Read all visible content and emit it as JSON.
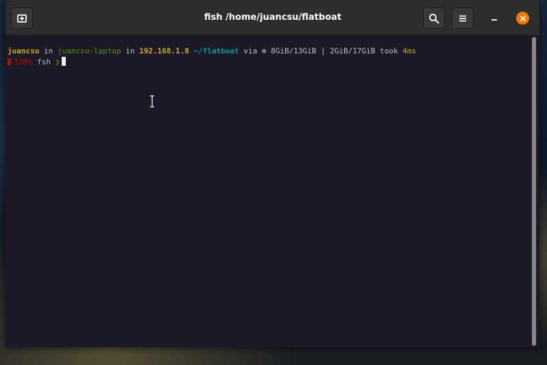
{
  "window": {
    "title": "fish /home/juancsu/flatboat"
  },
  "headerbar": {
    "new_tab_icon": "new-tab-icon",
    "search_icon": "search-icon",
    "menu_icon": "hamburger-menu-icon",
    "minimize_icon": "minimize-icon",
    "close_icon": "close-icon",
    "close_color": "#f57900"
  },
  "terminal": {
    "prompt": {
      "user": "juancsu",
      "in1": " in ",
      "host": "juancsu-laptop",
      "in2": " in ",
      "ip": "192.168.1.8",
      "space1": " ",
      "dir": "~/flatboat",
      "via": " via ",
      "mem_icon": "⊕",
      "mem": " 8GiB/13GiB | 2GiB/17GiB",
      "took": " took ",
      "duration": "4ms"
    },
    "line2": {
      "battery": "100%",
      "shell": " fsh ",
      "arrow": "❯"
    }
  },
  "colors": {
    "background": "#1b1a26",
    "headerbar": "#2d2d2d",
    "yellow": "#d3a61b",
    "green": "#4e9a06",
    "cyan": "#06989a",
    "red": "#cc0000"
  }
}
